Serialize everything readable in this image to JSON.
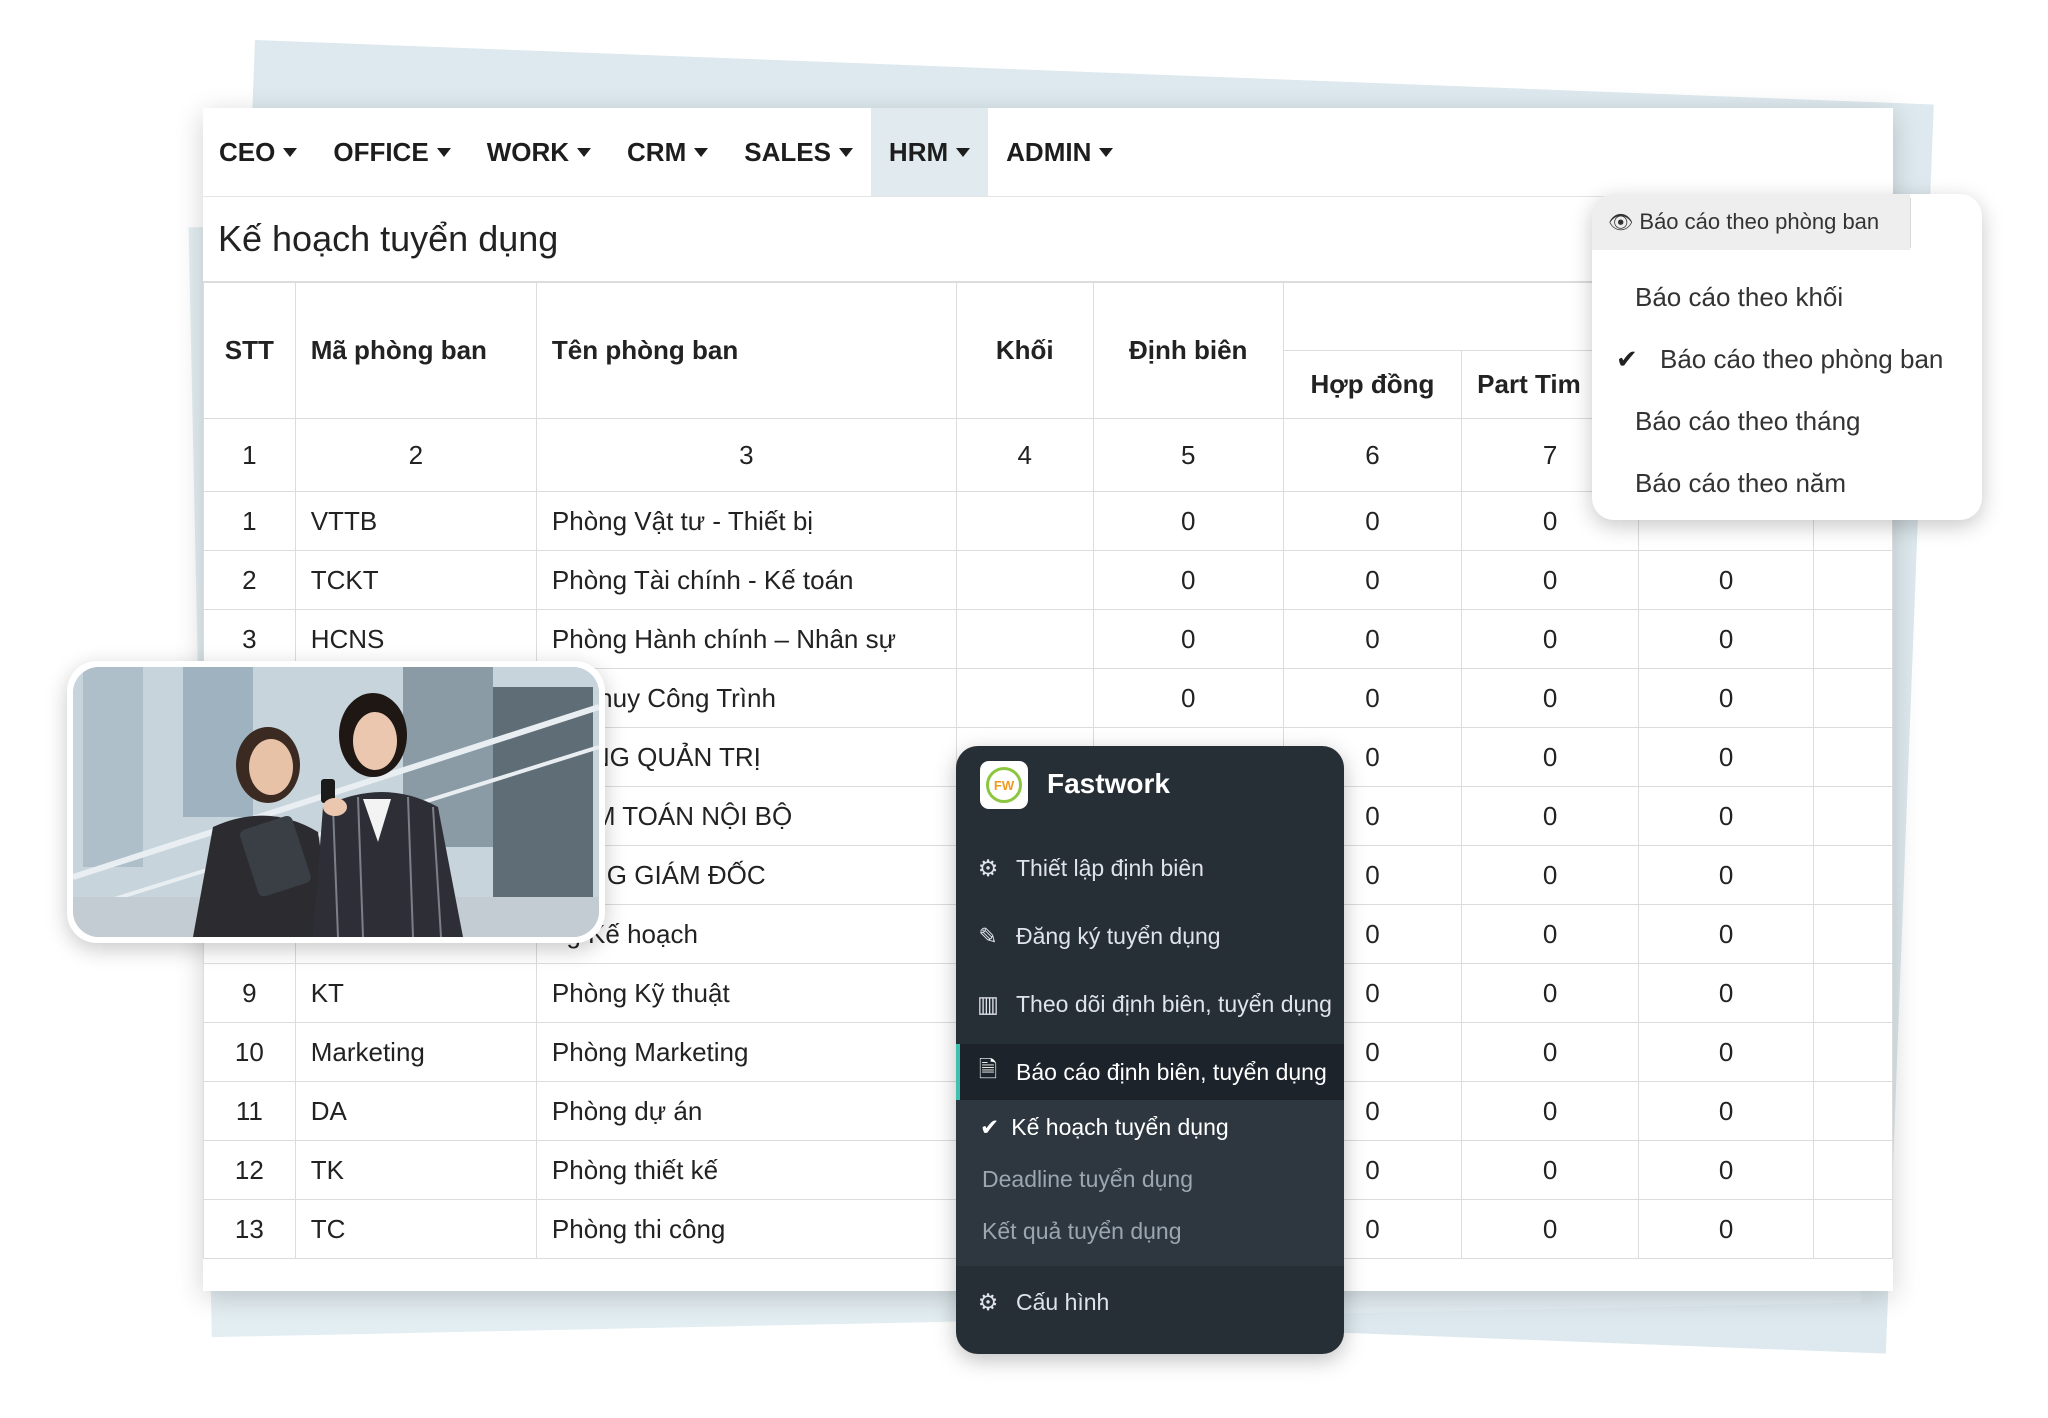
{
  "nav": {
    "items": [
      {
        "label": "CEO"
      },
      {
        "label": "OFFICE"
      },
      {
        "label": "WORK"
      },
      {
        "label": "CRM"
      },
      {
        "label": "SALES"
      },
      {
        "label": "HRM",
        "active": true
      },
      {
        "label": "ADMIN"
      }
    ]
  },
  "page": {
    "title": "Kế hoạch tuyển dụng"
  },
  "table": {
    "headers": {
      "stt": "STT",
      "ma": "Mã phòng ban",
      "ten": "Tên phòng ban",
      "khoi": "Khối",
      "dinh_bien": "Định biên",
      "hop_dong": "Hợp đồng",
      "part_time": "Part Tim"
    },
    "index_row": [
      "1",
      "2",
      "3",
      "4",
      "5",
      "6",
      "7"
    ],
    "rows": [
      {
        "stt": "1",
        "ma": "VTTB",
        "ten": "Phòng Vật tư - Thiết bị",
        "khoi": "",
        "dinh_bien": "0",
        "hop_dong": "0",
        "part_time": "0",
        "c8": ""
      },
      {
        "stt": "2",
        "ma": "TCKT",
        "ten": "Phòng Tài chính - Kế toán",
        "khoi": "",
        "dinh_bien": "0",
        "hop_dong": "0",
        "part_time": "0",
        "c8": "0"
      },
      {
        "stt": "3",
        "ma": "HCNS",
        "ten": "Phòng Hành chính – Nhân sự",
        "khoi": "",
        "dinh_bien": "0",
        "hop_dong": "0",
        "part_time": "0",
        "c8": "0"
      },
      {
        "stt": "",
        "ma": "",
        "ten": "Chỉ huy Công Trình",
        "khoi": "",
        "dinh_bien": "0",
        "hop_dong": "0",
        "part_time": "0",
        "c8": "0"
      },
      {
        "stt": "",
        "ma": "",
        "ten": "ĐỒNG QUẢN TRỊ",
        "khoi": "",
        "dinh_bien": "",
        "hop_dong": "0",
        "part_time": "0",
        "c8": "0"
      },
      {
        "stt": "",
        "ma": "",
        "ten": "KIỂM TOÁN NỘI BỘ",
        "khoi": "",
        "dinh_bien": "",
        "hop_dong": "0",
        "part_time": "0",
        "c8": "0"
      },
      {
        "stt": "",
        "ma": "",
        "ten": "TỔNG GIÁM ĐỐC",
        "khoi": "",
        "dinh_bien": "",
        "hop_dong": "0",
        "part_time": "0",
        "c8": "0"
      },
      {
        "stt": "",
        "ma": "",
        "ten": "ng Kế hoạch",
        "khoi": "",
        "dinh_bien": "",
        "hop_dong": "0",
        "part_time": "0",
        "c8": "0"
      },
      {
        "stt": "9",
        "ma": "KT",
        "ten": "Phòng Kỹ thuật",
        "khoi": "",
        "dinh_bien": "",
        "hop_dong": "0",
        "part_time": "0",
        "c8": "0"
      },
      {
        "stt": "10",
        "ma": "Marketing",
        "ten": "Phòng Marketing",
        "khoi": "",
        "dinh_bien": "",
        "hop_dong": "0",
        "part_time": "0",
        "c8": "0"
      },
      {
        "stt": "11",
        "ma": "DA",
        "ten": "Phòng dự án",
        "khoi": "",
        "dinh_bien": "",
        "hop_dong": "0",
        "part_time": "0",
        "c8": "0"
      },
      {
        "stt": "12",
        "ma": "TK",
        "ten": "Phòng thiết kế",
        "khoi": "",
        "dinh_bien": "",
        "hop_dong": "0",
        "part_time": "0",
        "c8": "0"
      },
      {
        "stt": "13",
        "ma": "TC",
        "ten": "Phòng thi công",
        "khoi": "",
        "dinh_bien": "",
        "hop_dong": "0",
        "part_time": "0",
        "c8": "0"
      }
    ]
  },
  "report_menu": {
    "current": "Báo cáo theo phòng ban",
    "options": [
      {
        "label": "Báo cáo theo khối",
        "checked": false
      },
      {
        "label": "Báo cáo theo phòng ban",
        "checked": true
      },
      {
        "label": "Báo cáo theo tháng",
        "checked": false
      },
      {
        "label": "Báo cáo theo năm",
        "checked": false
      }
    ]
  },
  "fastwork": {
    "logo_text": "FW",
    "title": "Fastwork",
    "items": [
      {
        "label": "Thiết lập định biên",
        "icon": "gears-icon"
      },
      {
        "label": "Đăng ký tuyển dụng",
        "icon": "edit-icon"
      },
      {
        "label": "Theo dõi định biên, tuyển dụng",
        "icon": "bar-chart-icon"
      },
      {
        "label": "Báo cáo định biên, tuyển dụng",
        "icon": "document-icon",
        "active": true
      }
    ],
    "sub_items": [
      {
        "label": "Kế hoạch tuyển dụng",
        "current": true
      },
      {
        "label": "Deadline tuyển dụng"
      },
      {
        "label": "Kết quả tuyển dụng"
      }
    ],
    "config": {
      "label": "Cấu hình",
      "icon": "gear-icon"
    }
  },
  "colors": {
    "nav_active_bg": "#e1ebef",
    "sidebar_bg": "#262e36",
    "sidebar_accent": "#3dc0b0",
    "logo_green": "#8cc63f",
    "logo_orange": "#f29a1e"
  }
}
